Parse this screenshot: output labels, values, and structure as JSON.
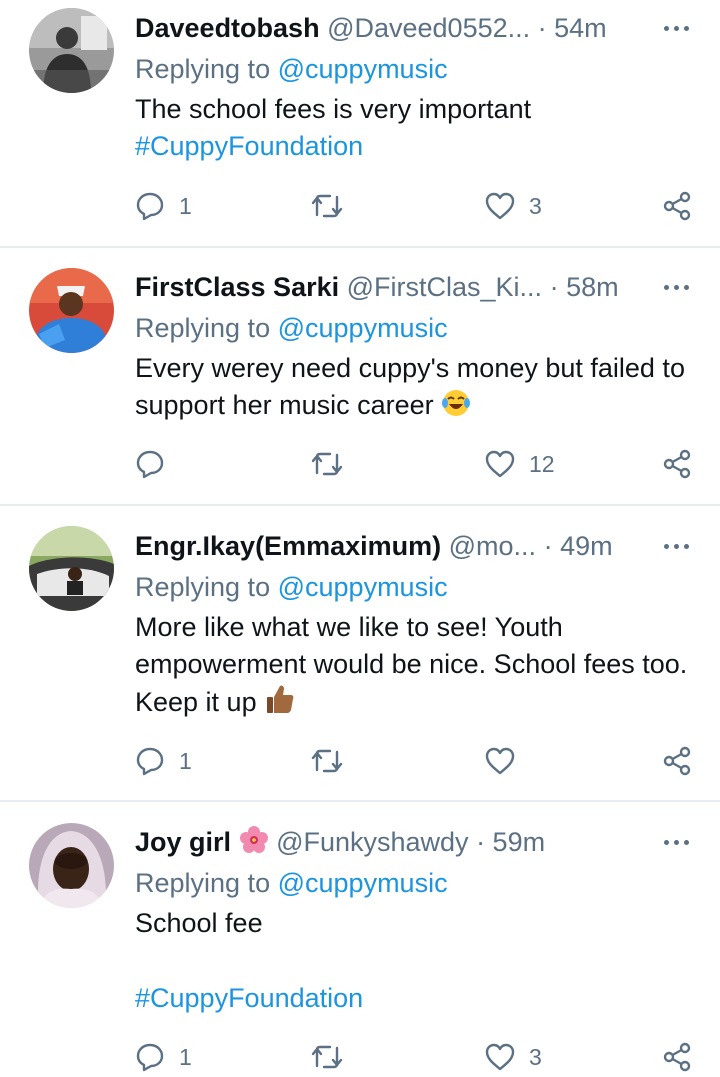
{
  "colors": {
    "accent": "#1b95e0",
    "secondary_text": "#5b7083",
    "divider": "#e6ecf0"
  },
  "tweets": [
    {
      "name": "Daveedtobash",
      "handle": "@Daveed0552...",
      "time": "· 54m",
      "replying_label": "Replying to",
      "replying_to": "@cuppymusic",
      "text": "The school fees is very important",
      "hashtag": "#CuppyFoundation",
      "replies": "1",
      "retweets": "",
      "likes": "3",
      "avatar_icon": "person-photo"
    },
    {
      "name": "FirstClass Sarki",
      "handle": "@FirstClas_Ki...",
      "time": "· 58m",
      "replying_label": "Replying to",
      "replying_to": "@cuppymusic",
      "text": "Every werey need cuppy's money but failed to support her music career",
      "emoji": "face-with-tears-of-joy",
      "replies": "",
      "retweets": "",
      "likes": "12",
      "avatar_icon": "person-photo"
    },
    {
      "name": "Engr.Ikay(Emmaximum)",
      "handle": "@mo...",
      "time": "· 49m",
      "replying_label": "Replying to",
      "replying_to": "@cuppymusic",
      "text": "More like what we like to see! Youth empowerment would be nice. School fees too. Keep it up",
      "emoji": "thumbs-up-medium-dark-skin",
      "replies": "1",
      "retweets": "",
      "likes": "",
      "avatar_icon": "person-in-car-photo"
    },
    {
      "name": "Joy girl",
      "name_emoji": "hibiscus",
      "handle": "@Funkyshawdy",
      "time": "· 59m",
      "replying_label": "Replying to",
      "replying_to": "@cuppymusic",
      "text": "School fee",
      "hashtag": "#CuppyFoundation",
      "replies": "1",
      "retweets": "",
      "likes": "3",
      "avatar_icon": "person-photo"
    }
  ]
}
